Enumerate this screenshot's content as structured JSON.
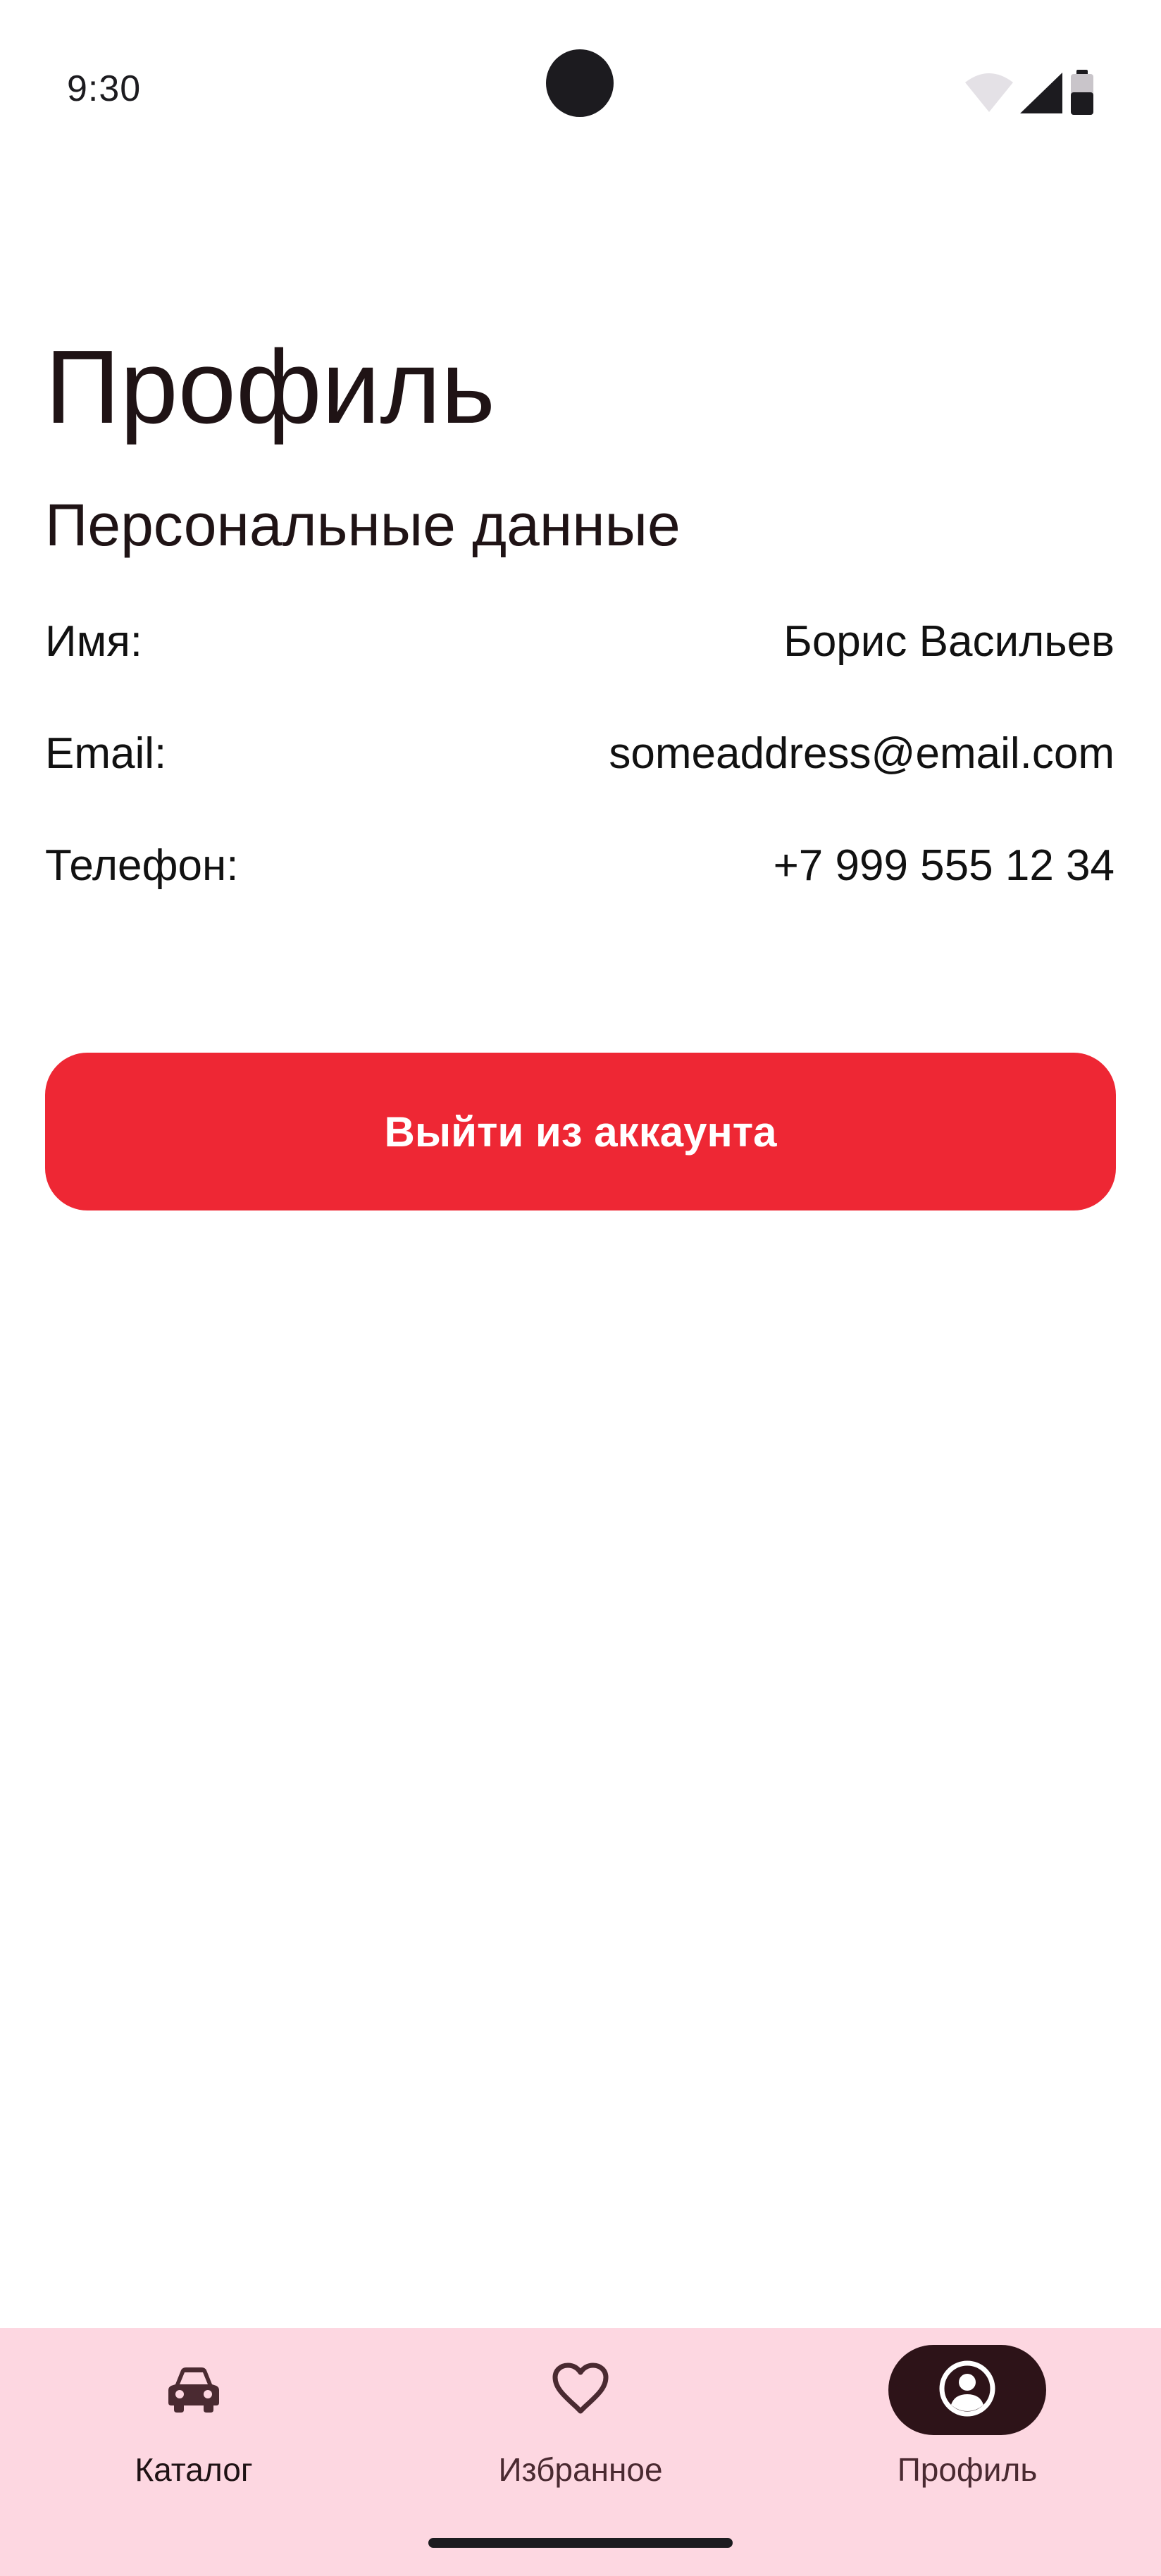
{
  "status_bar": {
    "time": "9:30"
  },
  "page": {
    "title": "Профиль",
    "section_title": "Персональные данные"
  },
  "personal_data": [
    {
      "label": "Имя:",
      "value": "Борис Васильев"
    },
    {
      "label": "Email:",
      "value": "someaddress@email.com"
    },
    {
      "label": "Телефон:",
      "value": "+7 999 555 12 34"
    }
  ],
  "logout_button": {
    "label": "Выйти из аккаунта"
  },
  "bottom_nav": {
    "items": [
      {
        "label": "Каталог",
        "icon": "car-icon",
        "active": false
      },
      {
        "label": "Избранное",
        "icon": "heart-icon",
        "active": false
      },
      {
        "label": "Профиль",
        "icon": "account-circle-icon",
        "active": true
      }
    ]
  },
  "colors": {
    "accent_red": "#ee2734",
    "nav_background": "#fdd7e1",
    "nav_active_pill": "#2d1318",
    "text_primary": "#1f1315"
  }
}
